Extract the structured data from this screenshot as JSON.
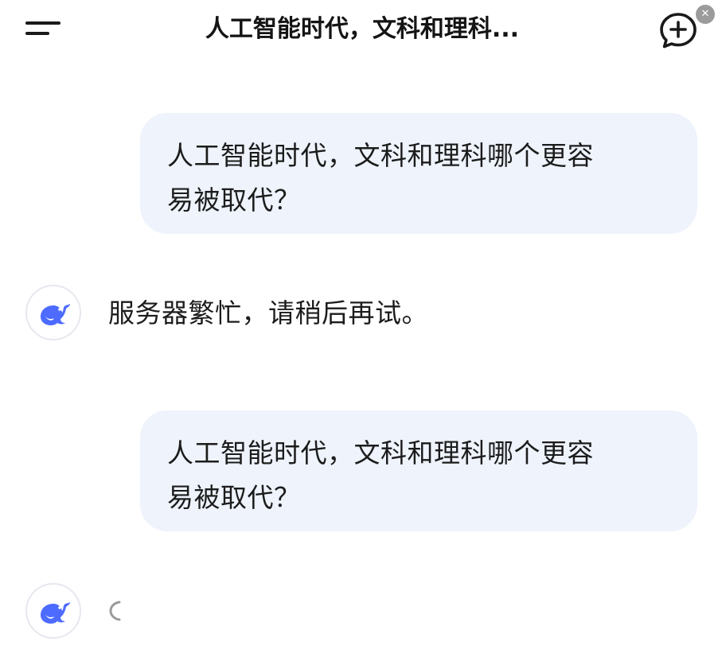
{
  "header": {
    "menu_icon": "menu-icon",
    "title": "人工智能时代，文科和理科...",
    "new_chat_icon": "new-chat-icon",
    "corner_badge_icon": "close-overlay-icon"
  },
  "messages": [
    {
      "role": "user",
      "lines": [
        "人工智能时代，文科和理科哪个更容",
        "易被取代？"
      ]
    },
    {
      "role": "assistant",
      "avatar_icon": "deepseek-whale-icon",
      "text": "服务器繁忙，请稍后再试。"
    },
    {
      "role": "user",
      "lines": [
        "人工智能时代，文科和理科哪个更容",
        "易被取代？"
      ]
    },
    {
      "role": "assistant",
      "avatar_icon": "deepseek-whale-icon",
      "status_icon": "loading-spinner-icon"
    }
  ],
  "colors": {
    "accent": "#4d6bfe",
    "bubble_bg": "#eef3fc",
    "text": "#1c1c1c"
  }
}
